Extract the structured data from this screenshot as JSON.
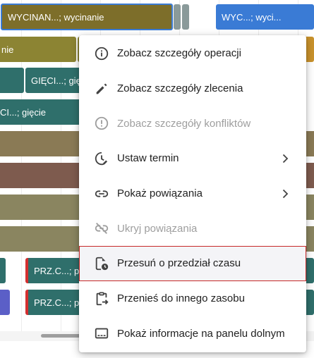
{
  "gantt": {
    "bars": [
      {
        "label": "WYCINAN...; wycinanie",
        "color": "#7d6e2a"
      },
      {
        "label": "",
        "color": "#8a9a9a"
      },
      {
        "label": "",
        "color": "#8a9a9a"
      },
      {
        "label": "WYC...; wyci...",
        "color": "#3a7bd5"
      },
      {
        "label": "nie",
        "color": "#8c8433"
      },
      {
        "label": "",
        "color": "#8c8433"
      },
      {
        "label": "",
        "color": "#c9922c"
      },
      {
        "label": "",
        "color": "#2f6f6b"
      },
      {
        "label": "GIĘCI...; gię",
        "color": "#2f6f6b"
      },
      {
        "label": "CI...; gięcie",
        "color": "#2f6f6b"
      },
      {
        "label": "",
        "color": "#8a7a55"
      },
      {
        "label": "",
        "color": "#7e5b4e"
      },
      {
        "label": "",
        "color": "#8a8560"
      },
      {
        "label": "",
        "color": "#8a8560"
      },
      {
        "label": "",
        "color": "#2f6f6b"
      },
      {
        "label": "PRZ.C...; pr",
        "color": "#2f6f6b"
      },
      {
        "label": "",
        "color": "#5b5fc7"
      },
      {
        "label": "PRZ.C...; pr",
        "color": "#2f6f6b"
      }
    ]
  },
  "context_menu": {
    "items": [
      {
        "label": "Zobacz szczegóły operacji",
        "icon": "info-icon",
        "disabled": false
      },
      {
        "label": "Zobacz szczegóły zlecenia",
        "icon": "pencil-icon",
        "disabled": false
      },
      {
        "label": "Zobacz szczegóły konfliktów",
        "icon": "alert-circle-icon",
        "disabled": true
      },
      {
        "label": "Ustaw termin",
        "icon": "clock-edit-icon",
        "disabled": false,
        "submenu": true
      },
      {
        "label": "Pokaż powiązania",
        "icon": "link-icon",
        "disabled": false,
        "submenu": true
      },
      {
        "label": "Ukryj powiązania",
        "icon": "link-off-icon",
        "disabled": true
      },
      {
        "label": "Przesuń o przedział czasu",
        "icon": "file-clock-icon",
        "disabled": false,
        "highlighted": true
      },
      {
        "label": "Przenieś do innego zasobu",
        "icon": "clipboard-arrow-icon",
        "disabled": false
      },
      {
        "label": "Pokaż informacje na panelu dolnym",
        "icon": "panel-bottom-icon",
        "disabled": false
      }
    ]
  },
  "colors": {
    "highlight_border": "#c62828",
    "disabled_text": "#9e9e9e",
    "text": "#212121"
  }
}
